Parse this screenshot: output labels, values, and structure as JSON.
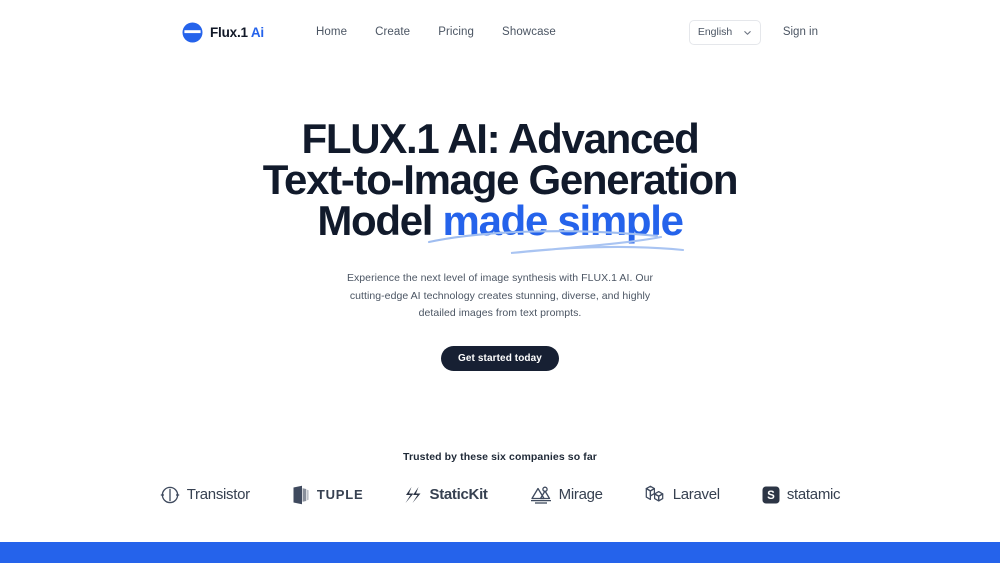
{
  "header": {
    "brand": {
      "name": "Flux.1",
      "suffix": "Ai",
      "logo_icon": "flux-circle-logo"
    },
    "nav": [
      {
        "label": "Home"
      },
      {
        "label": "Create"
      },
      {
        "label": "Pricing"
      },
      {
        "label": "Showcase"
      }
    ],
    "language": {
      "value": "English",
      "icon": "chevron-down-icon"
    },
    "signin_label": "Sign in"
  },
  "hero": {
    "headline_line1": "FLUX.1 AI: Advanced",
    "headline_line2": "Text-to-Image Generation",
    "headline_line3_prefix": "Model",
    "headline_accent": "made simple",
    "subheading": "Experience the next level of image synthesis with FLUX.1 AI. Our cutting-edge AI technology creates stunning, diverse, and highly detailed images from text prompts.",
    "cta_label": "Get started today"
  },
  "trusted": {
    "label": "Trusted by these six companies so far",
    "companies": [
      {
        "name": "Transistor",
        "icon": "transistor-icon",
        "style": "thin"
      },
      {
        "name": "TUPLE",
        "icon": "tuple-icon",
        "style": "caps"
      },
      {
        "name": "StaticKit",
        "icon": "statickit-icon",
        "style": "bold"
      },
      {
        "name": "Mirage",
        "icon": "mirage-icon",
        "style": "thin"
      },
      {
        "name": "Laravel",
        "icon": "laravel-icon",
        "style": "thin"
      },
      {
        "name": "statamic",
        "icon": "statamic-icon",
        "style": "thin"
      }
    ]
  },
  "colors": {
    "brand_blue": "#2563eb",
    "headline_navy": "#111a2b",
    "cta_bg": "#172033",
    "swoosh_blue": "#93b4ec",
    "footer_band": "#2563eb"
  }
}
